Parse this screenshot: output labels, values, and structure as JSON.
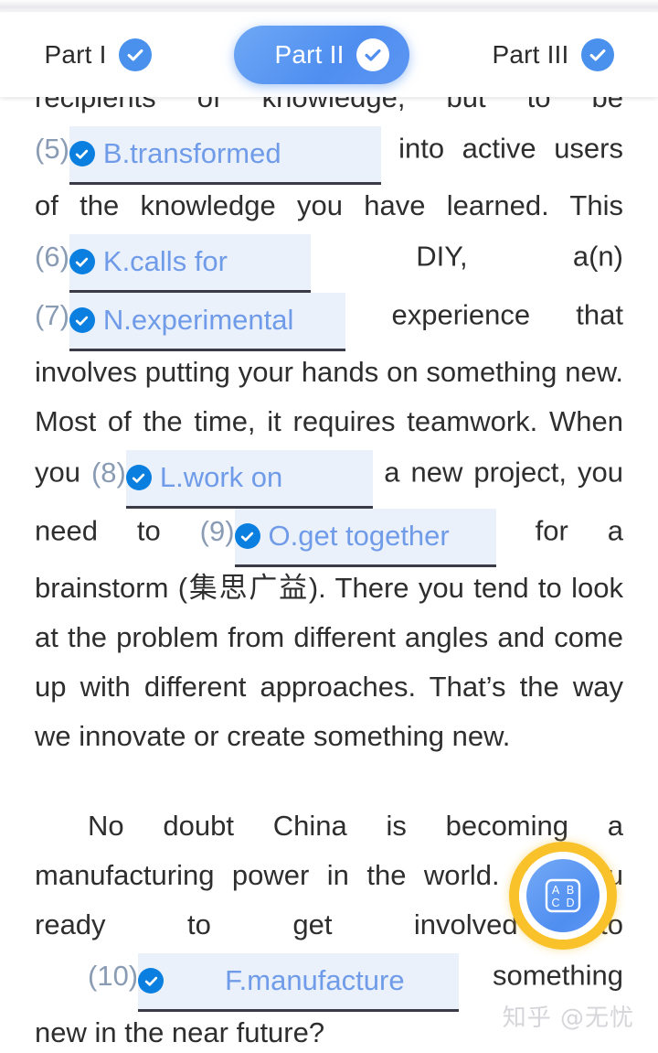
{
  "header": {
    "tabs": [
      {
        "label": "Part I",
        "icon": "check-circle-icon",
        "active": false
      },
      {
        "label": "Part II",
        "icon": "check-circle-icon",
        "active": true
      },
      {
        "label": "Part III",
        "icon": "check-circle-icon",
        "active": false
      }
    ]
  },
  "colors": {
    "accent_blue": "#4a90ed",
    "active_tab_blue": "#5d96f2",
    "answer_blue": "#6f9be8",
    "blank_highlight": "#eaf1fb",
    "blank_underline": "#3b3b47",
    "badge_blue": "#0a7fe0",
    "fab_ring_yellow": "#f9c22b",
    "body_text": "#2e2e2e",
    "blank_number": "#8a9bb4",
    "watermark": "#d6d6da"
  },
  "passage": {
    "p1": {
      "seg_a": "recipients of knowledge, but to be ",
      "blank5": {
        "number": "(5)",
        "answer": "B.transformed",
        "icon": "check-circle-icon"
      },
      "seg_b": " into active users of the knowledge you have learned. This ",
      "blank6": {
        "number": "(6)",
        "answer": "K.calls for",
        "icon": "check-circle-icon"
      },
      "seg_c": " DIY, a(n) ",
      "blank7": {
        "number": "(7)",
        "answer": "N.experimental",
        "icon": "check-circle-icon"
      },
      "seg_d": " experience that involves putting your hands on something new. Most of the time, it requires teamwork. When you ",
      "blank8": {
        "number": "(8)",
        "answer": "L.work on",
        "icon": "check-circle-icon"
      },
      "seg_e": " a new project, you need to ",
      "blank9": {
        "number": "(9)",
        "answer": "O.get together",
        "icon": "check-circle-icon"
      },
      "seg_f": " for a brainstorm (集思广益). There you tend to look at the problem from different angles and come up with different approaches. That’s the way we innovate or create something new."
    },
    "p2": {
      "seg_a": "No doubt China is becoming a manufacturing power in the world. Are you ready to get involved to ",
      "blank10": {
        "number": "(10)",
        "answer": "F.manufacture",
        "icon": "check-circle-icon"
      },
      "seg_b": " something new in the near future?"
    }
  },
  "fab": {
    "name": "answer-sheet-button",
    "icon": "abcd-options-icon",
    "letters": [
      "A",
      "B",
      "C",
      "D"
    ]
  },
  "watermark": {
    "text": "知乎 @无忧"
  }
}
